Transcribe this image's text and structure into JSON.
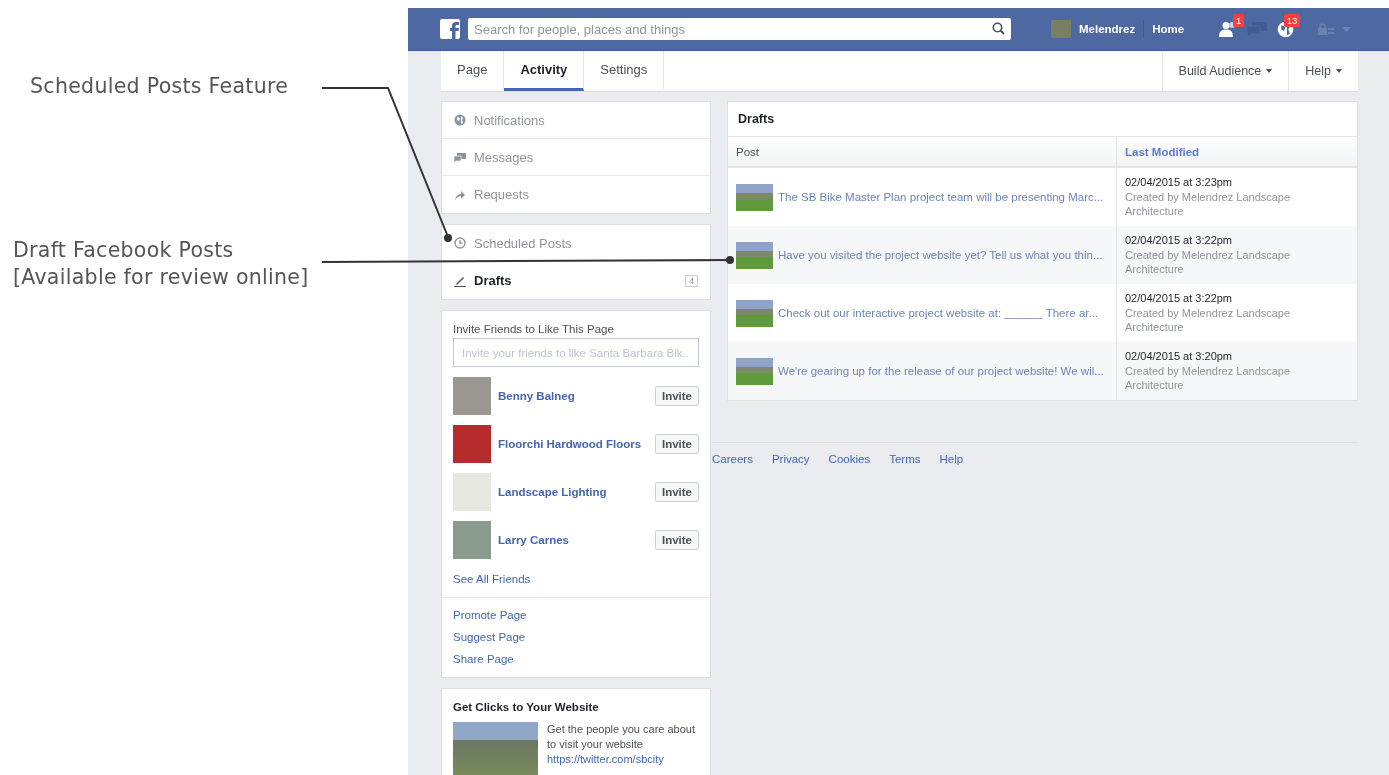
{
  "annotations": [
    {
      "lines": [
        "Scheduled Posts Feature"
      ]
    },
    {
      "lines": [
        "Draft Facebook Posts",
        "[Available for review online]"
      ]
    }
  ],
  "topbar": {
    "search_placeholder": "Search for people, places and things",
    "profile_name": "Melendrez",
    "home": "Home",
    "friend_badge": "1",
    "notification_badge": "13"
  },
  "tabs": [
    {
      "label": "Page",
      "selected": false
    },
    {
      "label": "Activity",
      "selected": true
    },
    {
      "label": "Settings",
      "selected": false
    }
  ],
  "right_menu": [
    "Build Audience",
    "Help"
  ],
  "sidebar": {
    "groups": [
      {
        "items": [
          {
            "kind": "globe",
            "label": "Notifications",
            "selected": false
          },
          {
            "kind": "messages",
            "label": "Messages",
            "selected": false
          },
          {
            "kind": "share",
            "label": "Requests",
            "selected": false
          }
        ]
      },
      {
        "items": [
          {
            "kind": "clock",
            "label": "Scheduled Posts",
            "selected": false
          },
          {
            "kind": "pencil",
            "label": "Drafts",
            "selected": true,
            "count": "4"
          }
        ]
      }
    ]
  },
  "invite": {
    "title": "Invite Friends to Like This Page",
    "placeholder": "Invite your friends to like Santa Barbara Bik...",
    "friends": [
      {
        "name": "Benny Balneg",
        "button": "Invite"
      },
      {
        "name": "Floorchi Hardwood Floors",
        "button": "Invite"
      },
      {
        "name": "Landscape Lighting",
        "button": "Invite"
      },
      {
        "name": "Larry Carnes",
        "button": "Invite"
      }
    ],
    "see_all": "See All Friends"
  },
  "page_links": [
    "Promote Page",
    "Suggest Page",
    "Share Page"
  ],
  "ad": {
    "title": "Get Clicks to Your Website",
    "text": "Get the people you care about to visit your website",
    "url": "https://twitter.com/sbcity"
  },
  "drafts": {
    "title": "Drafts",
    "columns": [
      {
        "label": "Post",
        "sorted": false
      },
      {
        "label": "Last Modified",
        "sorted": true
      }
    ],
    "rows": [
      {
        "post": "The SB Bike Master Plan project team will be presenting Marc...",
        "date": "02/04/2015 at 3:23pm",
        "creator": "Created by Melendrez Landscape Architecture"
      },
      {
        "post": "Have you visited the project website yet? Tell us what you thin...",
        "date": "02/04/2015 at 3:22pm",
        "creator": "Created by Melendrez Landscape Architecture"
      },
      {
        "post": "Check out our interactive project website at: ______ There ar...",
        "date": "02/04/2015 at 3:22pm",
        "creator": "Created by Melendrez Landscape Architecture"
      },
      {
        "post": "We're gearing up for the release of our project website! We wil...",
        "date": "02/04/2015 at 3:20pm",
        "creator": "Created by Melendrez Landscape Architecture"
      }
    ]
  },
  "footer_links": [
    "Careers",
    "Privacy",
    "Cookies",
    "Terms",
    "Help"
  ]
}
